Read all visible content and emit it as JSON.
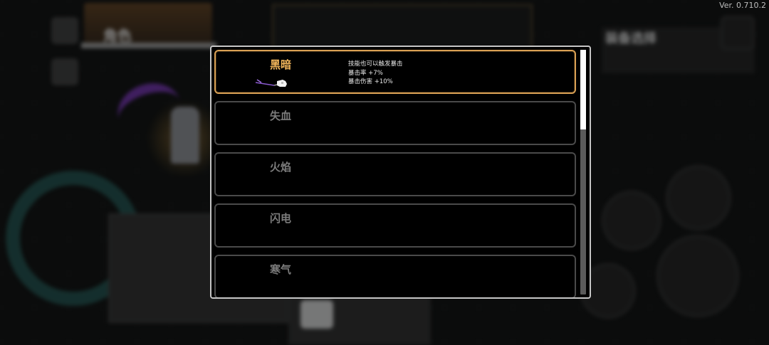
{
  "version": "Ver. 0.710.2",
  "background": {
    "character_title": "角色",
    "right_panel_title": "装备选择"
  },
  "dialog": {
    "items": [
      {
        "name": "黑暗",
        "selected": true,
        "icon": "dark-scythe-icon",
        "description": [
          "技能也可以触发暴击",
          "暴击率 +7%",
          "暴击伤害 +10%"
        ]
      },
      {
        "name": "失血",
        "selected": false
      },
      {
        "name": "火焰",
        "selected": false
      },
      {
        "name": "闪电",
        "selected": false
      },
      {
        "name": "寒气",
        "selected": false
      }
    ]
  },
  "colors": {
    "selected_border": "#d9a054",
    "selected_title": "#f0b45a",
    "inactive_title": "#7c7c7c",
    "row_border": "#4a4a4a",
    "dialog_border": "#c6c6c6"
  }
}
